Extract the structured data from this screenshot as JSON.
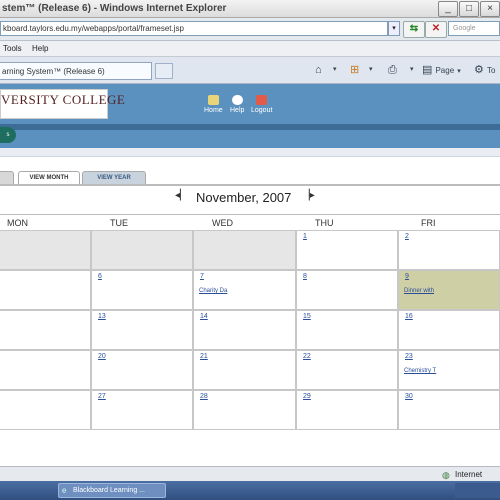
{
  "window": {
    "title": "stem™ (Release 6) - Windows Internet Explorer"
  },
  "address_bar": {
    "url": "kboard.taylors.edu.my/webapps/portal/frameset.jsp",
    "search_placeholder": "Google"
  },
  "menu": {
    "items": [
      "Tools",
      "Help"
    ]
  },
  "tabs": {
    "active_label": "arning System™ (Release 6)"
  },
  "toolbar": {
    "page_label": "Page",
    "tools_label": "To"
  },
  "header": {
    "logo_line1": "VERSITY COLLEGE",
    "logo_line2": "",
    "nav": [
      "Home",
      "Help",
      "Logout"
    ]
  },
  "view_tabs": {
    "month": "VIEW MONTH",
    "year": "VIEW YEAR"
  },
  "calendar": {
    "month_title": "November, 2007",
    "days": [
      "MON",
      "TUE",
      "WED",
      "THU",
      "FRI"
    ],
    "weeks": [
      [
        {
          "day": "",
          "event": ""
        },
        {
          "day": "",
          "event": ""
        },
        {
          "day": "",
          "event": ""
        },
        {
          "day": "1",
          "event": ""
        },
        {
          "day": "2",
          "event": ""
        }
      ],
      [
        {
          "day": "",
          "event": ""
        },
        {
          "day": "6",
          "event": ""
        },
        {
          "day": "7",
          "event": "Charity Da"
        },
        {
          "day": "8",
          "event": ""
        },
        {
          "day": "9",
          "event": "Dinner with"
        }
      ],
      [
        {
          "day": "",
          "event": ""
        },
        {
          "day": "13",
          "event": ""
        },
        {
          "day": "14",
          "event": ""
        },
        {
          "day": "15",
          "event": ""
        },
        {
          "day": "16",
          "event": ""
        }
      ],
      [
        {
          "day": "",
          "event": ""
        },
        {
          "day": "20",
          "event": ""
        },
        {
          "day": "21",
          "event": ""
        },
        {
          "day": "22",
          "event": ""
        },
        {
          "day": "23",
          "event": "Chemistry T"
        }
      ],
      [
        {
          "day": "",
          "event": ""
        },
        {
          "day": "27",
          "event": ""
        },
        {
          "day": "28",
          "event": ""
        },
        {
          "day": "29",
          "event": ""
        },
        {
          "day": "30",
          "event": ""
        }
      ]
    ]
  },
  "status": {
    "zone": "Internet"
  },
  "taskbar": {
    "item": "Blackboard Learning ..."
  },
  "colors": {
    "header_blue": "#5a91bf",
    "highlight_cell": "#cfcfa5",
    "link": "#2a4f9a"
  }
}
